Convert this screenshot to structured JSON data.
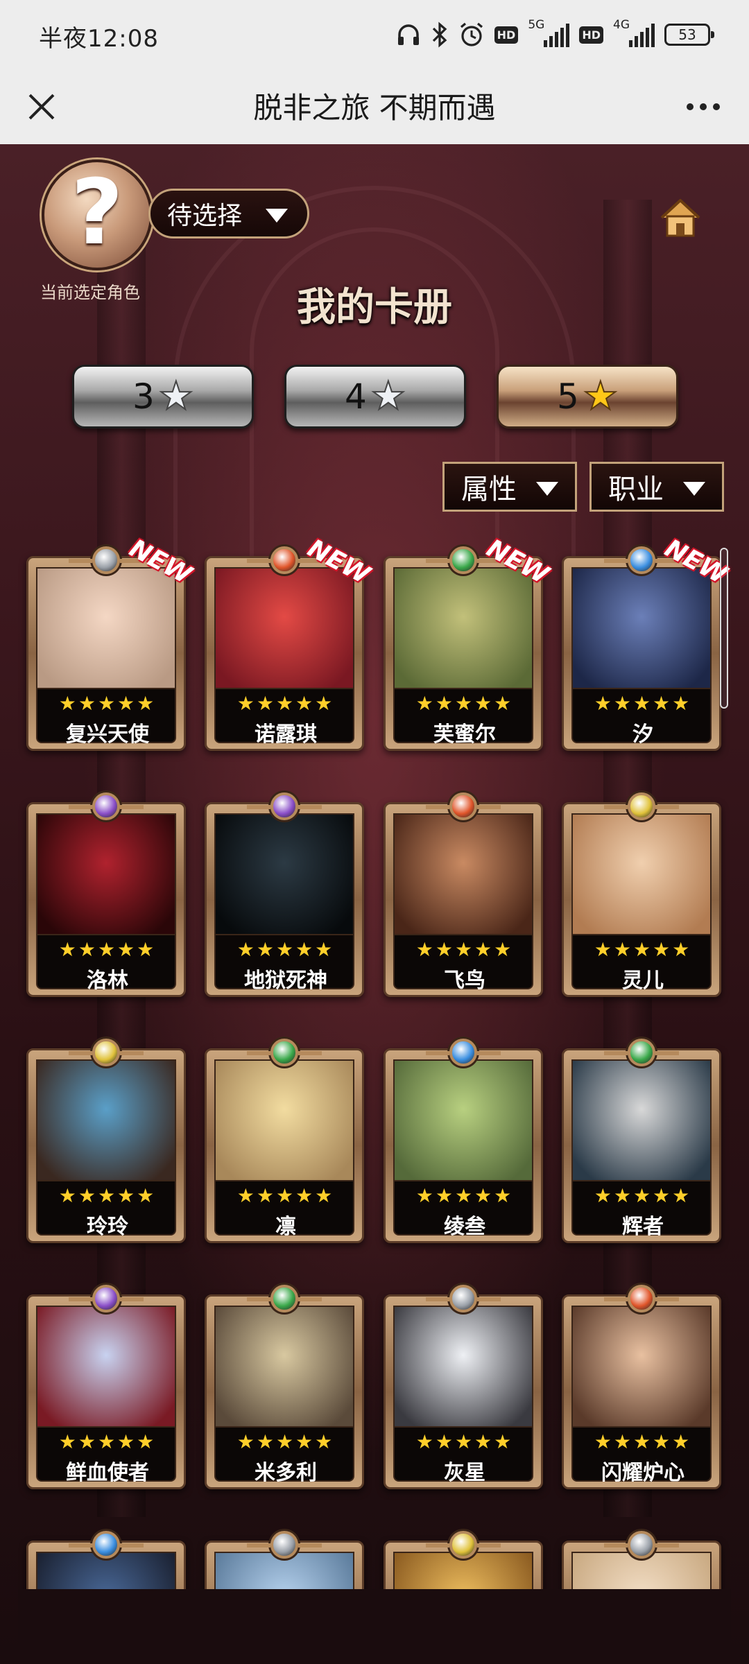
{
  "status_bar": {
    "time": "半夜12:08",
    "network1": "5G",
    "network2": "4G",
    "hd_label": "HD",
    "battery": "53"
  },
  "titlebar": {
    "title": "脱非之旅 不期而遇"
  },
  "character_select": {
    "avatar_glyph": "?",
    "value": "待选择",
    "caption": "当前选定角色"
  },
  "album": {
    "title": "我的卡册"
  },
  "star_tabs": [
    {
      "label": "3",
      "selected": false
    },
    {
      "label": "4",
      "selected": false
    },
    {
      "label": "5",
      "selected": true
    }
  ],
  "star_glyph": "★",
  "filters": {
    "attribute": "属性",
    "job": "职业"
  },
  "cards": [
    {
      "name": "复兴天使",
      "stars": "★★★★★",
      "new": "NEW",
      "gem_color": "#9aa0a8",
      "art": [
        "#f4d7c4",
        "#b99a84"
      ]
    },
    {
      "name": "诺露琪",
      "stars": "★★★★★",
      "new": "NEW",
      "gem_color": "#e0552a",
      "art": [
        "#e34a45",
        "#7a1822"
      ]
    },
    {
      "name": "芙蜜尔",
      "stars": "★★★★★",
      "new": "NEW",
      "gem_color": "#3aa84a",
      "art": [
        "#c2c07a",
        "#5b6a36"
      ]
    },
    {
      "name": "汐",
      "stars": "★★★★★",
      "new": "NEW",
      "gem_color": "#3a8ee0",
      "art": [
        "#6b7fb8",
        "#1d2748"
      ]
    },
    {
      "name": "洛林",
      "stars": "★★★★★",
      "new": "",
      "gem_color": "#8a4ec8",
      "art": [
        "#b0222e",
        "#2a0608"
      ]
    },
    {
      "name": "地狱死神",
      "stars": "★★★★★",
      "new": "",
      "gem_color": "#8a4ec8",
      "art": [
        "#2c3a44",
        "#070a0c"
      ]
    },
    {
      "name": "飞鸟",
      "stars": "★★★★★",
      "new": "",
      "gem_color": "#e0552a",
      "art": [
        "#c98a62",
        "#4a2618"
      ]
    },
    {
      "name": "灵儿",
      "stars": "★★★★★",
      "new": "",
      "gem_color": "#e0c23a",
      "art": [
        "#f0cfae",
        "#b27c52"
      ]
    },
    {
      "name": "玲玲",
      "stars": "★★★★★",
      "new": "",
      "gem_color": "#e0c23a",
      "art": [
        "#5a9fc8",
        "#3a2820"
      ]
    },
    {
      "name": "凛",
      "stars": "★★★★★",
      "new": "",
      "gem_color": "#3aa84a",
      "art": [
        "#f2dca0",
        "#a8885a"
      ]
    },
    {
      "name": "绫叁",
      "stars": "★★★★★",
      "new": "",
      "gem_color": "#3a8ee0",
      "art": [
        "#b8d080",
        "#556a3a"
      ]
    },
    {
      "name": "辉者",
      "stars": "★★★★★",
      "new": "",
      "gem_color": "#3aa84a",
      "art": [
        "#d8d8d8",
        "#2a3a48"
      ]
    },
    {
      "name": "鲜血使者",
      "stars": "★★★★★",
      "new": "",
      "gem_color": "#8a4ec8",
      "art": [
        "#c8d2f0",
        "#7a1a24"
      ]
    },
    {
      "name": "米多利",
      "stars": "★★★★★",
      "new": "",
      "gem_color": "#3aa84a",
      "art": [
        "#d8c8a0",
        "#5a4a3a"
      ]
    },
    {
      "name": "灰星",
      "stars": "★★★★★",
      "new": "",
      "gem_color": "#9aa0a8",
      "art": [
        "#eef0f4",
        "#3a3a40"
      ]
    },
    {
      "name": "闪耀炉心",
      "stars": "★★★★★",
      "new": "",
      "gem_color": "#e0552a",
      "art": [
        "#e8c0a0",
        "#5a3a2a"
      ]
    },
    {
      "name": "",
      "stars": "",
      "new": "",
      "gem_color": "#3a8ee0",
      "art": [
        "#4a6a9a",
        "#1a2030"
      ]
    },
    {
      "name": "",
      "stars": "",
      "new": "",
      "gem_color": "#9aa0a8",
      "art": [
        "#b8d4f0",
        "#5a7a9a"
      ]
    },
    {
      "name": "",
      "stars": "",
      "new": "",
      "gem_color": "#e0c23a",
      "art": [
        "#f0c060",
        "#8a5a20"
      ]
    },
    {
      "name": "",
      "stars": "",
      "new": "",
      "gem_color": "#9aa0a8",
      "art": [
        "#f4e0c8",
        "#c8a880"
      ]
    }
  ],
  "colors": {
    "gold_frame": "#c9a47c",
    "star": "#ffcf2a",
    "new_badge": "#d3162a"
  }
}
